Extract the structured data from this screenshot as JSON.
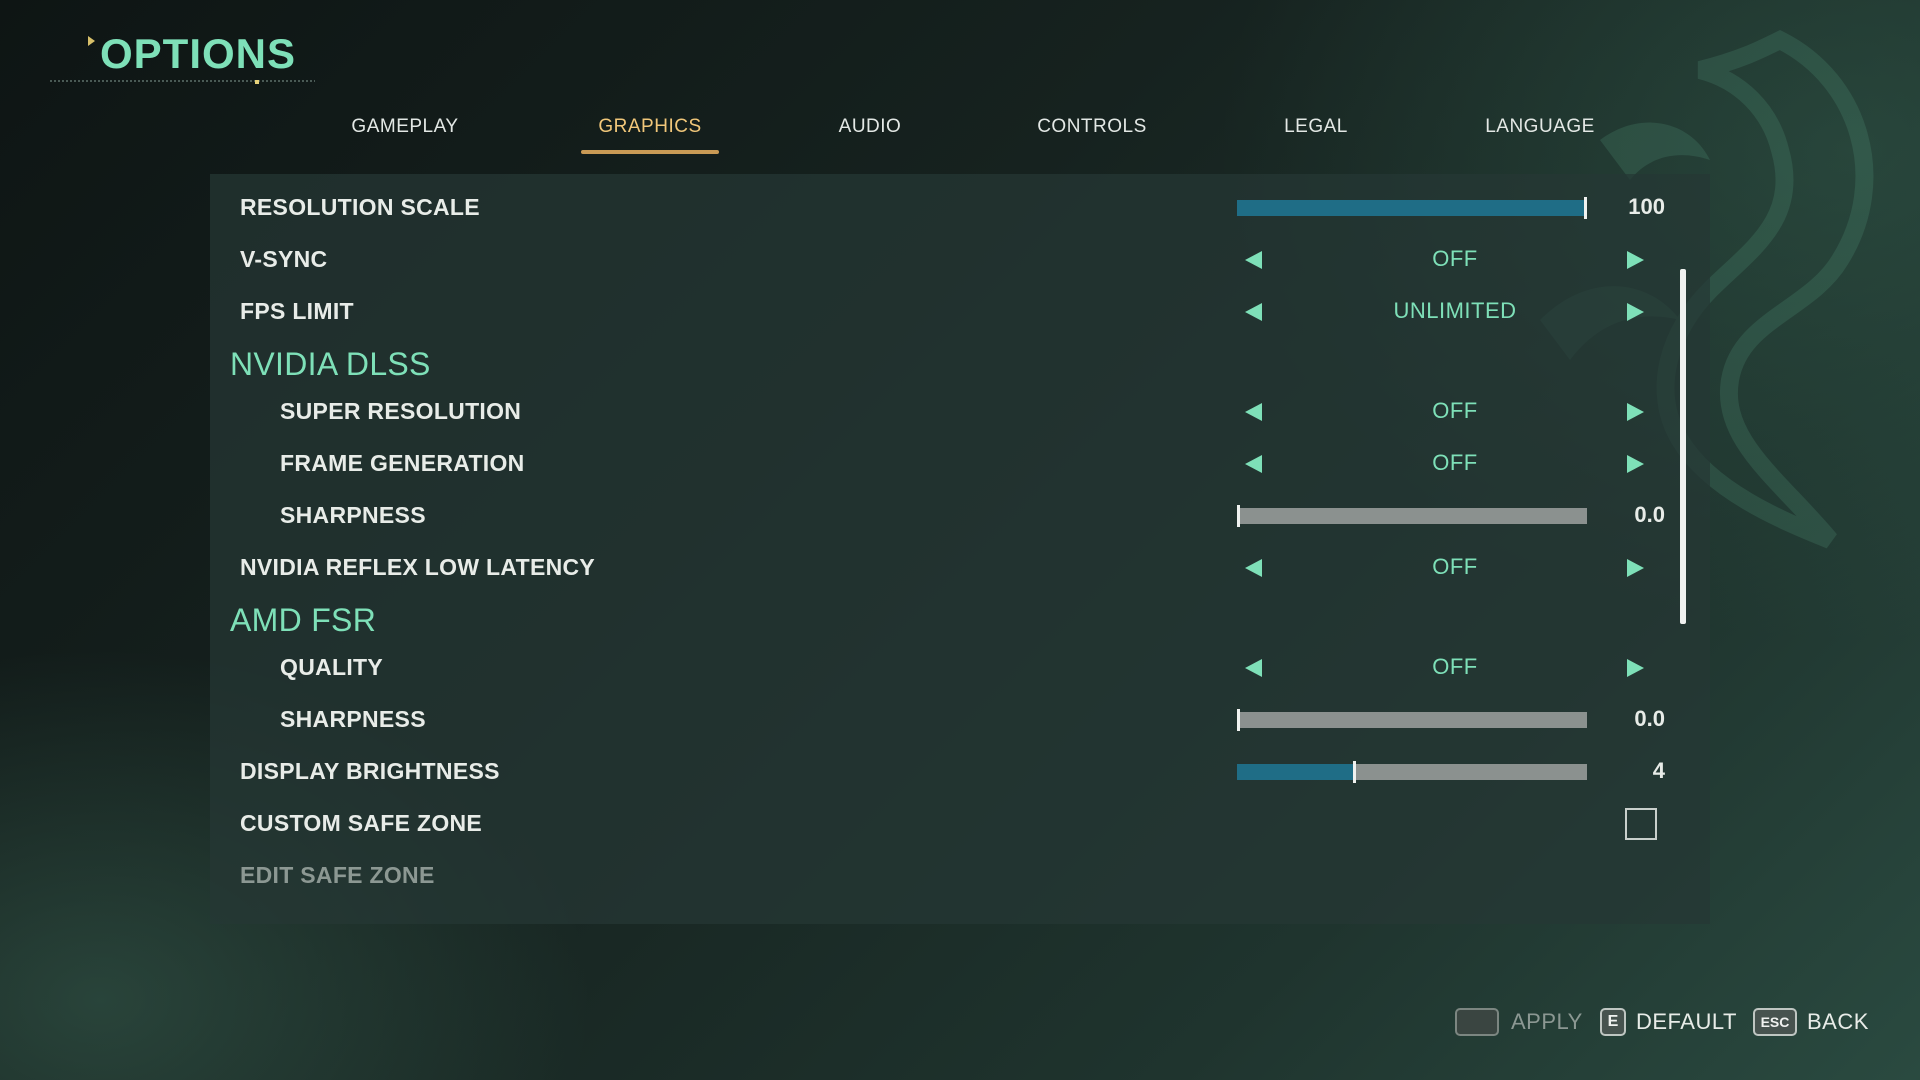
{
  "header": {
    "title": "OPTIONS"
  },
  "tabs": [
    {
      "label": "GAMEPLAY",
      "active": false
    },
    {
      "label": "GRAPHICS",
      "active": true
    },
    {
      "label": "AUDIO",
      "active": false
    },
    {
      "label": "CONTROLS",
      "active": false
    },
    {
      "label": "LEGAL",
      "active": false
    },
    {
      "label": "LANGUAGE",
      "active": false
    }
  ],
  "settings": {
    "resolution_scale": {
      "label": "RESOLUTION SCALE",
      "value": "100",
      "fraction": 1.0
    },
    "vsync": {
      "label": "V-SYNC",
      "value": "OFF"
    },
    "fps_limit": {
      "label": "FPS LIMIT",
      "value": "UNLIMITED"
    },
    "dlss_section": "NVIDIA DLSS",
    "super_resolution": {
      "label": "SUPER RESOLUTION",
      "value": "OFF"
    },
    "frame_generation": {
      "label": "FRAME GENERATION",
      "value": "OFF"
    },
    "dlss_sharpness": {
      "label": "SHARPNESS",
      "value": "0.0",
      "fraction": 0.0
    },
    "reflex": {
      "label": "NVIDIA REFLEX LOW LATENCY",
      "value": "OFF"
    },
    "fsr_section": "AMD FSR",
    "fsr_quality": {
      "label": "QUALITY",
      "value": "OFF"
    },
    "fsr_sharpness": {
      "label": "SHARPNESS",
      "value": "0.0",
      "fraction": 0.0
    },
    "display_brightness": {
      "label": "DISPLAY BRIGHTNESS",
      "value": "4",
      "fraction": 0.33
    },
    "custom_safe_zone": {
      "label": "CUSTOM SAFE ZONE",
      "checked": false
    },
    "edit_safe_zone": {
      "label": "EDIT SAFE ZONE",
      "enabled": false
    }
  },
  "footer": {
    "apply": {
      "key": "",
      "label": "APPLY",
      "enabled": false
    },
    "default": {
      "key": "E",
      "label": "DEFAULT"
    },
    "back": {
      "key": "ESC",
      "label": "BACK"
    }
  },
  "colors": {
    "accent": "#7ee0b8",
    "tab_active": "#f1c77a",
    "slider_fill": "#1f6d86"
  }
}
